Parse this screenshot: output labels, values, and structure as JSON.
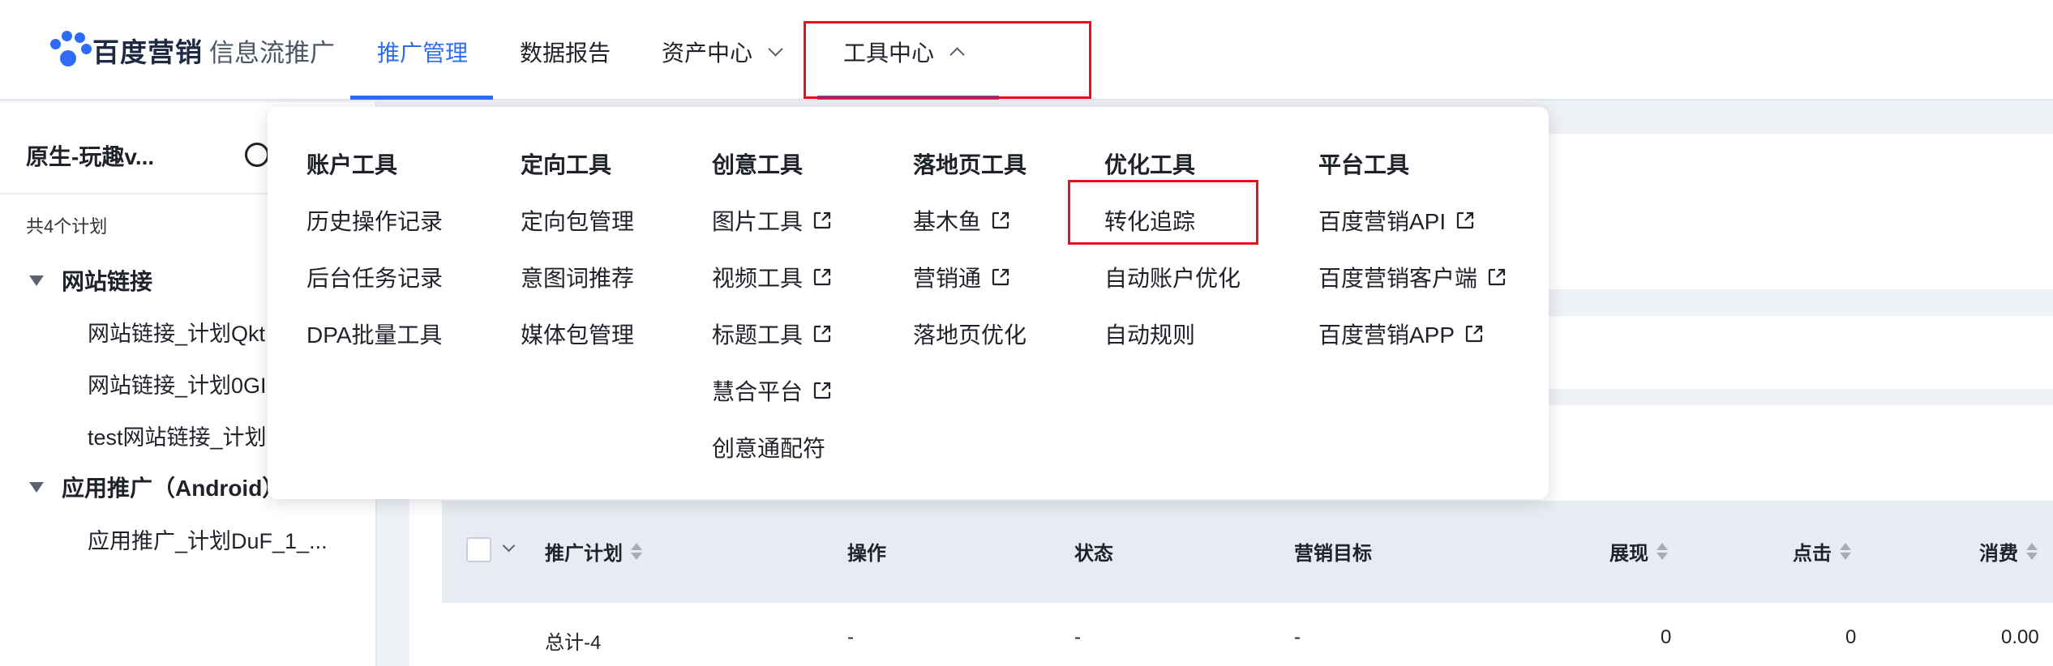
{
  "header": {
    "brand": "百度营销",
    "product": "信息流推广",
    "nav": [
      {
        "label": "推广管理"
      },
      {
        "label": "数据报告"
      },
      {
        "label": "资产中心"
      },
      {
        "label": "工具中心"
      }
    ],
    "accent_color": "#2f6cf6"
  },
  "sidebar": {
    "account": "原生-玩趣v...",
    "plan_count": "共4个计划",
    "groups": [
      {
        "label": "网站链接",
        "items": [
          "网站链接_计划Qkt",
          "网站链接_计划0GI",
          "test网站链接_计划"
        ]
      },
      {
        "label": "应用推广（Android）",
        "items": [
          "应用推广_计划DuF_1_..."
        ]
      }
    ]
  },
  "dropdown": {
    "columns": [
      {
        "heading": "账户工具",
        "items": [
          {
            "label": "历史操作记录"
          },
          {
            "label": "后台任务记录"
          },
          {
            "label": "DPA批量工具"
          }
        ]
      },
      {
        "heading": "定向工具",
        "items": [
          {
            "label": "定向包管理"
          },
          {
            "label": "意图词推荐"
          },
          {
            "label": "媒体包管理"
          }
        ]
      },
      {
        "heading": "创意工具",
        "items": [
          {
            "label": "图片工具",
            "external": true
          },
          {
            "label": "视频工具",
            "external": true
          },
          {
            "label": "标题工具",
            "external": true
          },
          {
            "label": "慧合平台",
            "external": true
          },
          {
            "label": "创意通配符"
          }
        ]
      },
      {
        "heading": "落地页工具",
        "items": [
          {
            "label": "基木鱼",
            "external": true
          },
          {
            "label": "营销通",
            "external": true
          },
          {
            "label": "落地页优化"
          }
        ]
      },
      {
        "heading": "优化工具",
        "items": [
          {
            "label": "转化追踪"
          },
          {
            "label": "自动账户优化"
          },
          {
            "label": "自动规则"
          }
        ]
      },
      {
        "heading": "平台工具",
        "items": [
          {
            "label": "百度营销API",
            "external": true
          },
          {
            "label": "百度营销客户端",
            "external": true
          },
          {
            "label": "百度营销APP",
            "external": true
          }
        ]
      }
    ]
  },
  "table": {
    "headers": [
      "推广计划",
      "操作",
      "状态",
      "营销目标",
      "展现",
      "点击",
      "消费"
    ],
    "total_row": [
      "总计-4",
      "-",
      "-",
      "-",
      "0",
      "0",
      "0.00"
    ]
  },
  "highlight_color": "#e8101a"
}
